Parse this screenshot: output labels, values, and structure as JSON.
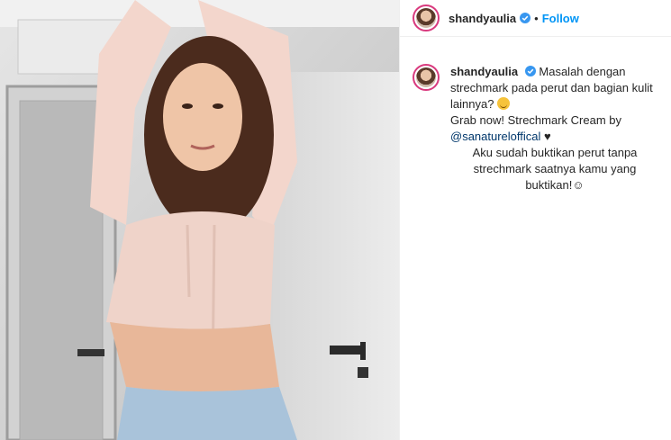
{
  "post": {
    "username": "shandyaulia",
    "follow_label": "Follow",
    "separator": "•",
    "caption": {
      "line1": "Masalah dengan strechmark pada perut dan bagian kulit lainnya?",
      "line2": "Grab now! Strechmark Cream by",
      "mention": "@sanatureloffical",
      "heart": "♥",
      "line3": "Aku sudah buktikan perut tanpa strechmark saatnya kamu yang buktikan!",
      "smile": "☺"
    }
  },
  "icons": {
    "verified": "verified-badge-icon",
    "emoji": "disappointed-face-emoji-icon"
  },
  "colors": {
    "accent": "#0095f6",
    "verified": "#3897f0",
    "text": "#262626",
    "mention": "#00376b"
  }
}
